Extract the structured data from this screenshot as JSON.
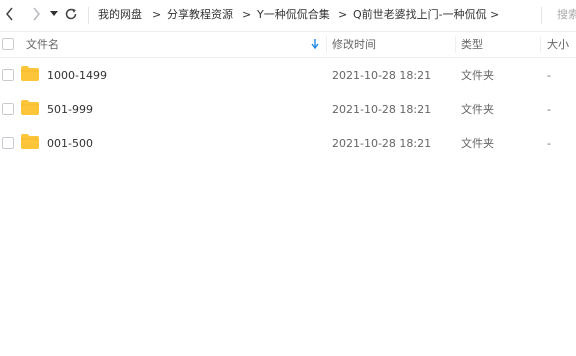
{
  "toolbar": {
    "breadcrumb": [
      "我的网盘",
      "分享教程资源",
      "Y一种侃侃合集",
      "Q前世老婆找上门-一种侃侃"
    ],
    "separator": ">",
    "search_placeholder": "搜索"
  },
  "columns": {
    "name": "文件名",
    "modified": "修改时间",
    "type": "类型",
    "size": "大小"
  },
  "sort_direction": "descending",
  "files": [
    {
      "name": "1000-1499",
      "modified": "2021-10-28 18:21",
      "type": "文件夹",
      "size": "-"
    },
    {
      "name": "501-999",
      "modified": "2021-10-28 18:21",
      "type": "文件夹",
      "size": "-"
    },
    {
      "name": "001-500",
      "modified": "2021-10-28 18:21",
      "type": "文件夹",
      "size": "-"
    }
  ],
  "colors": {
    "folder": "#fcc53a",
    "accent": "#1e88e5"
  }
}
